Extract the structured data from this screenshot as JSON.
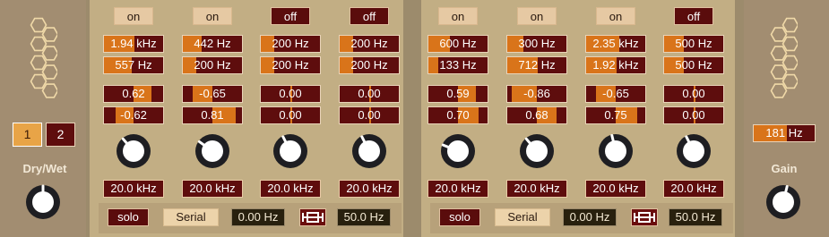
{
  "left": {
    "tabs": [
      "1",
      "2"
    ],
    "active_tab": 0,
    "label": "Dry/Wet",
    "knob_value": 0.5
  },
  "right": {
    "freq_value": "181 Hz",
    "freq_fill": 0.55,
    "label": "Gain",
    "knob_value": 0.55
  },
  "groups": [
    {
      "bands": [
        {
          "state": "on",
          "freq_hi": {
            "text": "1.94 kHz",
            "fill": 0.52
          },
          "freq_lo": {
            "text": "557 Hz",
            "fill": 0.47
          },
          "param_a": {
            "text": "0.62",
            "fill": 0.81
          },
          "param_b": {
            "text": "-0.62",
            "fill": 0.19
          },
          "knob": 0.35,
          "cutoff": "20.0 kHz"
        },
        {
          "state": "on",
          "freq_hi": {
            "text": "442 Hz",
            "fill": 0.32
          },
          "freq_lo": {
            "text": "200 Hz",
            "fill": 0.22
          },
          "param_a": {
            "text": "-0.65",
            "fill": 0.17
          },
          "param_b": {
            "text": "0.81",
            "fill": 0.9
          },
          "knob": 0.3,
          "cutoff": "20.0 kHz"
        },
        {
          "state": "off",
          "freq_hi": {
            "text": "200 Hz",
            "fill": 0.22
          },
          "freq_lo": {
            "text": "200 Hz",
            "fill": 0.22
          },
          "param_a": {
            "text": "0.00",
            "fill": 0.5
          },
          "param_b": {
            "text": "0.00",
            "fill": 0.5
          },
          "knob": 0.4,
          "cutoff": "20.0 kHz"
        },
        {
          "state": "off",
          "freq_hi": {
            "text": "200 Hz",
            "fill": 0.22
          },
          "freq_lo": {
            "text": "200 Hz",
            "fill": 0.22
          },
          "param_a": {
            "text": "0.00",
            "fill": 0.5
          },
          "param_b": {
            "text": "0.00",
            "fill": 0.5
          },
          "knob": 0.4,
          "cutoff": "20.0 kHz"
        }
      ],
      "solo": "solo",
      "mode": "Serial",
      "shift": "0.00 Hz",
      "link_icon": "link-chain-icon",
      "rate": "50.0 Hz"
    },
    {
      "bands": [
        {
          "state": "on",
          "freq_hi": {
            "text": "600 Hz",
            "fill": 0.36
          },
          "freq_lo": {
            "text": "133 Hz",
            "fill": 0.17
          },
          "param_a": {
            "text": "0.59",
            "fill": 0.8
          },
          "param_b": {
            "text": "0.70",
            "fill": 0.85
          },
          "knob": 0.25,
          "cutoff": "20.0 kHz"
        },
        {
          "state": "on",
          "freq_hi": {
            "text": "300 Hz",
            "fill": 0.28
          },
          "freq_lo": {
            "text": "712 Hz",
            "fill": 0.52
          },
          "param_a": {
            "text": "-0.86",
            "fill": 0.07
          },
          "param_b": {
            "text": "0.68",
            "fill": 0.84
          },
          "knob": 0.35,
          "cutoff": "20.0 kHz"
        },
        {
          "state": "on",
          "freq_hi": {
            "text": "2.35 kHz",
            "fill": 0.56
          },
          "freq_lo": {
            "text": "1.92 kHz",
            "fill": 0.52
          },
          "param_a": {
            "text": "-0.65",
            "fill": 0.17
          },
          "param_b": {
            "text": "0.75",
            "fill": 0.87
          },
          "knob": 0.45,
          "cutoff": "20.0 kHz"
        },
        {
          "state": "off",
          "freq_hi": {
            "text": "500 Hz",
            "fill": 0.34
          },
          "freq_lo": {
            "text": "500 Hz",
            "fill": 0.34
          },
          "param_a": {
            "text": "0.00",
            "fill": 0.5
          },
          "param_b": {
            "text": "0.00",
            "fill": 0.5
          },
          "knob": 0.4,
          "cutoff": "20.0 kHz"
        }
      ],
      "solo": "solo",
      "mode": "Serial",
      "shift": "0.00 Hz",
      "link_icon": "link-chain-icon",
      "rate": "50.0 Hz"
    }
  ],
  "colors": {
    "accent": "#d9741a",
    "field": "#5e0d0d",
    "panel": "#c2ae84",
    "side": "#a28d71"
  }
}
